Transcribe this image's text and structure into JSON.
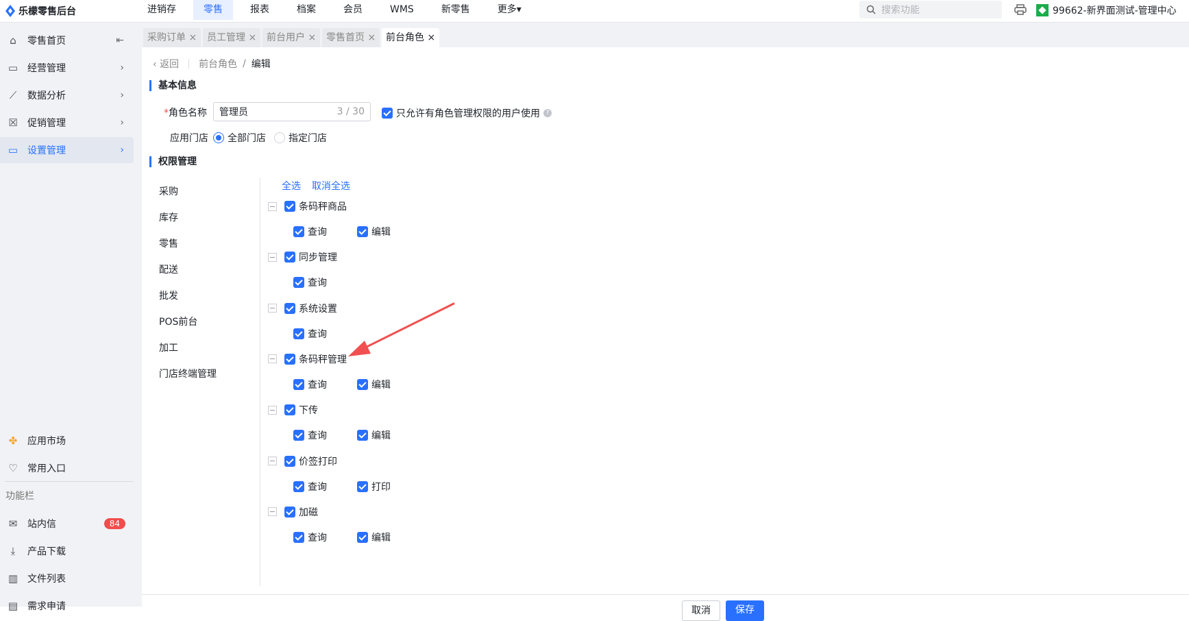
{
  "app": {
    "title": "乐檬零售后台"
  },
  "nav": [
    "进销存",
    "零售",
    "报表",
    "档案",
    "会员",
    "WMS",
    "新零售",
    "更多▾"
  ],
  "search": {
    "placeholder": "搜索功能"
  },
  "org": "99662-新界面测试-管理中心",
  "sidebar": {
    "items": [
      "零售首页",
      "经营管理",
      "数据分析",
      "促销管理",
      "设置管理"
    ],
    "bottom": [
      "应用市场",
      "常用入口"
    ],
    "section_label": "功能栏",
    "tools": [
      "站内信",
      "产品下载",
      "文件列表",
      "需求申请"
    ],
    "message_count": "84"
  },
  "tabs": [
    "采购订单",
    "员工管理",
    "前台用户",
    "零售首页",
    "前台角色"
  ],
  "breadcrumb": {
    "back": "返回",
    "parent": "前台角色",
    "current": "编辑",
    "sep": "/"
  },
  "basic": {
    "title": "基本信息",
    "name_label": "角色名称",
    "name_value": "管理员",
    "name_count": "3 / 30",
    "restrict_label": "只允许有角色管理权限的用户使用",
    "store_label": "应用门店",
    "store_all": "全部门店",
    "store_specific": "指定门店"
  },
  "perm": {
    "title": "权限管理",
    "categories": [
      "采购",
      "库存",
      "零售",
      "配送",
      "批发",
      "POS前台",
      "加工",
      "门店终端管理"
    ],
    "select_all": "全选",
    "deselect_all": "取消全选",
    "groups": [
      {
        "name": "条码秤商品",
        "children": [
          "查询",
          "编辑"
        ]
      },
      {
        "name": "同步管理",
        "children": [
          "查询"
        ]
      },
      {
        "name": "系统设置",
        "children": [
          "查询"
        ]
      },
      {
        "name": "条码秤管理",
        "children": [
          "查询",
          "编辑"
        ]
      },
      {
        "name": "下传",
        "children": [
          "查询",
          "编辑"
        ]
      },
      {
        "name": "价签打印",
        "children": [
          "查询",
          "打印"
        ]
      },
      {
        "name": "加磁",
        "children": [
          "查询",
          "编辑"
        ]
      }
    ]
  },
  "footer": {
    "cancel": "取消",
    "save": "保存"
  },
  "colors": {
    "accent": "#2970ff",
    "annotation": "#f05050"
  }
}
